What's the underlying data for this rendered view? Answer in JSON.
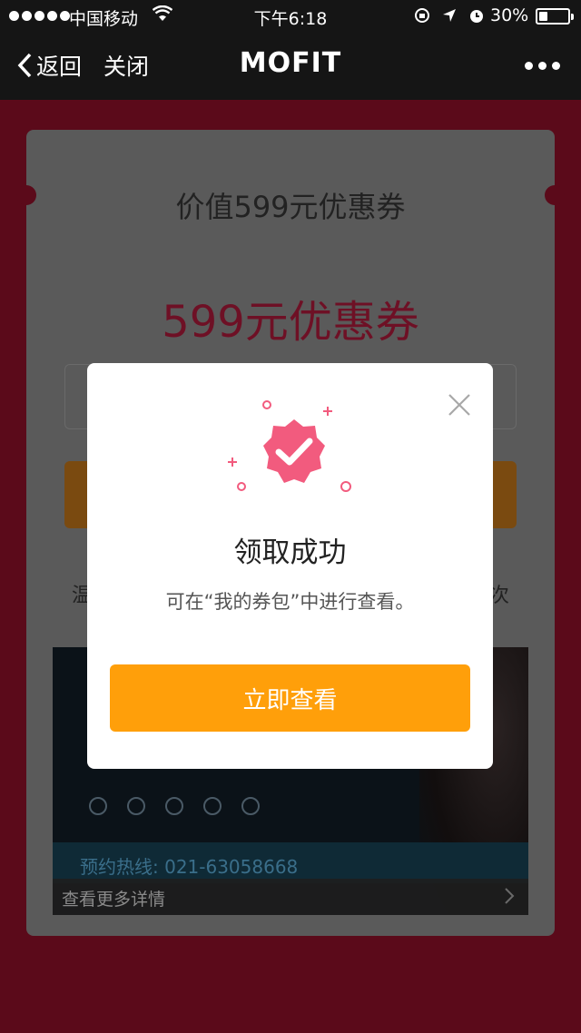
{
  "status_bar": {
    "carrier": "中国移动",
    "time": "下午6:18",
    "battery_percent": "30%",
    "battery_level": 0.3
  },
  "nav": {
    "back_label": "返回",
    "close_label": "关闭",
    "title": "MOFIT"
  },
  "page": {
    "coupon_label": "价值599元优惠券",
    "coupon_name": "599元优惠券",
    "side_text_left": "温",
    "side_text_right": "次",
    "banner": {
      "hotline": "预约热线: 021-63058668",
      "more_details": "查看更多详情"
    }
  },
  "modal": {
    "title": "领取成功",
    "message": "可在“我的券包”中进行查看。",
    "button_label": "立即查看"
  },
  "colors": {
    "accent": "#ff9f0a",
    "badge_pink": "#f25b7e",
    "background": "#5b0a1a"
  }
}
